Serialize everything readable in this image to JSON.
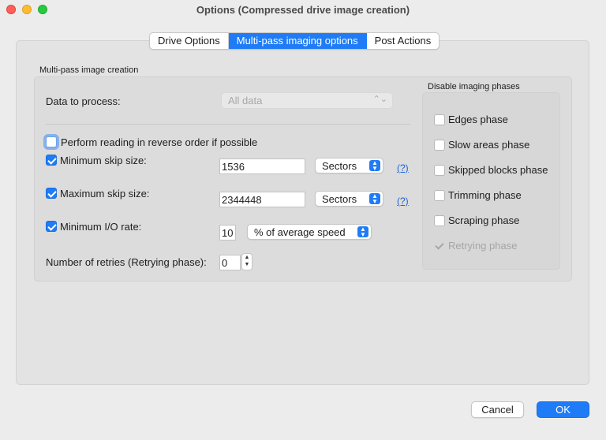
{
  "window": {
    "title": "Options (Compressed drive image creation)"
  },
  "tabs": [
    "Drive Options",
    "Multi-pass imaging options",
    "Post Actions"
  ],
  "active_tab": "Multi-pass imaging options",
  "section_title": "Multi-pass image creation",
  "data_to_process": {
    "label": "Data to process:",
    "value": "All data"
  },
  "reverse_order": {
    "label": "Perform reading in reverse order if possible",
    "checked": false
  },
  "min_skip": {
    "label": "Minimum skip size:",
    "checked": true,
    "value": "1536",
    "unit": "Sectors",
    "help": "(?)"
  },
  "max_skip": {
    "label": "Maximum skip size:",
    "checked": true,
    "value": "2344448",
    "unit": "Sectors",
    "help": "(?)"
  },
  "min_io": {
    "label": "Minimum I/O rate:",
    "checked": true,
    "value": "10",
    "unit": "% of average speed"
  },
  "retries": {
    "label": "Number of retries (Retrying phase):",
    "value": "0"
  },
  "phases": {
    "title": "Disable imaging phases",
    "items": [
      {
        "label": "Edges phase",
        "checked": false,
        "enabled": true
      },
      {
        "label": "Slow areas phase",
        "checked": false,
        "enabled": true
      },
      {
        "label": "Skipped blocks phase",
        "checked": false,
        "enabled": true
      },
      {
        "label": "Trimming phase",
        "checked": false,
        "enabled": true
      },
      {
        "label": "Scraping phase",
        "checked": false,
        "enabled": true
      },
      {
        "label": "Retrying phase",
        "checked": true,
        "enabled": false
      }
    ]
  },
  "buttons": {
    "cancel": "Cancel",
    "ok": "OK"
  },
  "colors": {
    "accent": "#1f7cf6",
    "link": "#1a64d8",
    "panel": "#e3e3e3"
  }
}
